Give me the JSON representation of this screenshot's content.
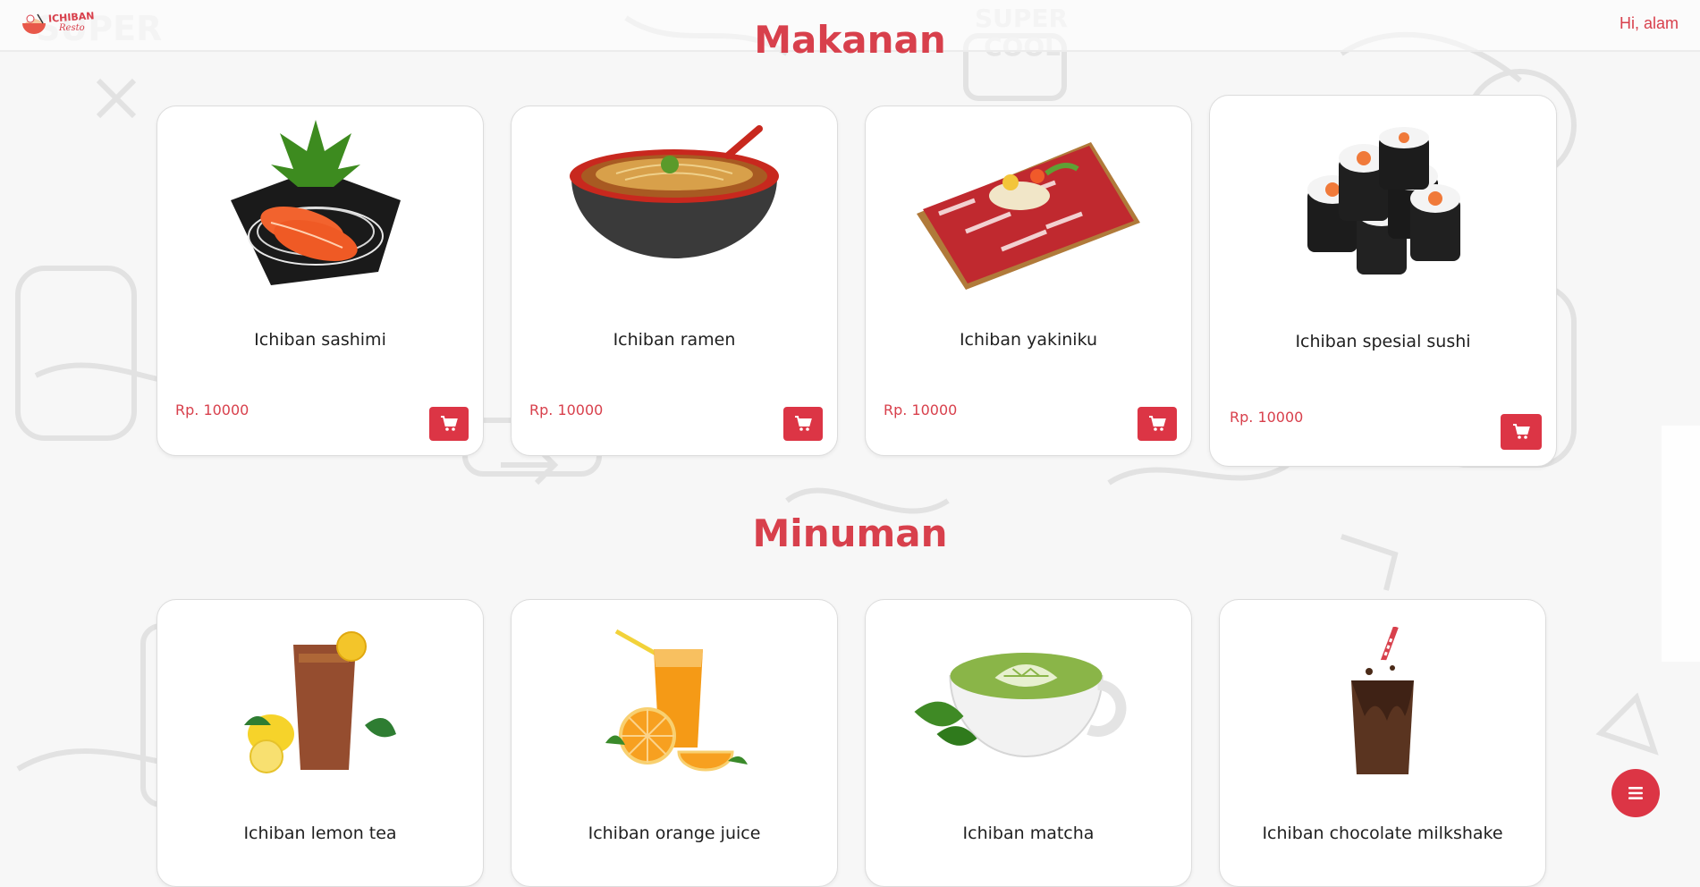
{
  "header": {
    "logo_text": "ICHIBAN",
    "logo_sub": "Resto",
    "greeting": "Hi, alam"
  },
  "sections": [
    {
      "title": "Makanan",
      "items": [
        {
          "name": "Ichiban sashimi",
          "price": "Rp. 10000",
          "icon": "sashimi-image"
        },
        {
          "name": "Ichiban ramen",
          "price": "Rp. 10000",
          "icon": "ramen-image"
        },
        {
          "name": "Ichiban yakiniku",
          "price": "Rp. 10000",
          "icon": "yakiniku-image"
        },
        {
          "name": "Ichiban spesial sushi",
          "price": "Rp. 10000",
          "icon": "sushi-image"
        }
      ]
    },
    {
      "title": "Minuman",
      "items": [
        {
          "name": "Ichiban lemon tea",
          "icon": "lemon-tea-image"
        },
        {
          "name": "Ichiban orange juice",
          "icon": "orange-juice-image"
        },
        {
          "name": "Ichiban matcha",
          "icon": "matcha-image"
        },
        {
          "name": "Ichiban chocolate milkshake",
          "icon": "chocolate-milkshake-image"
        }
      ]
    }
  ],
  "icons": {
    "cart": "shopping-cart-icon",
    "menu": "menu-icon"
  },
  "colors": {
    "accent": "#dc3545",
    "title": "#d8404c",
    "card_border": "#dcdcdc"
  }
}
